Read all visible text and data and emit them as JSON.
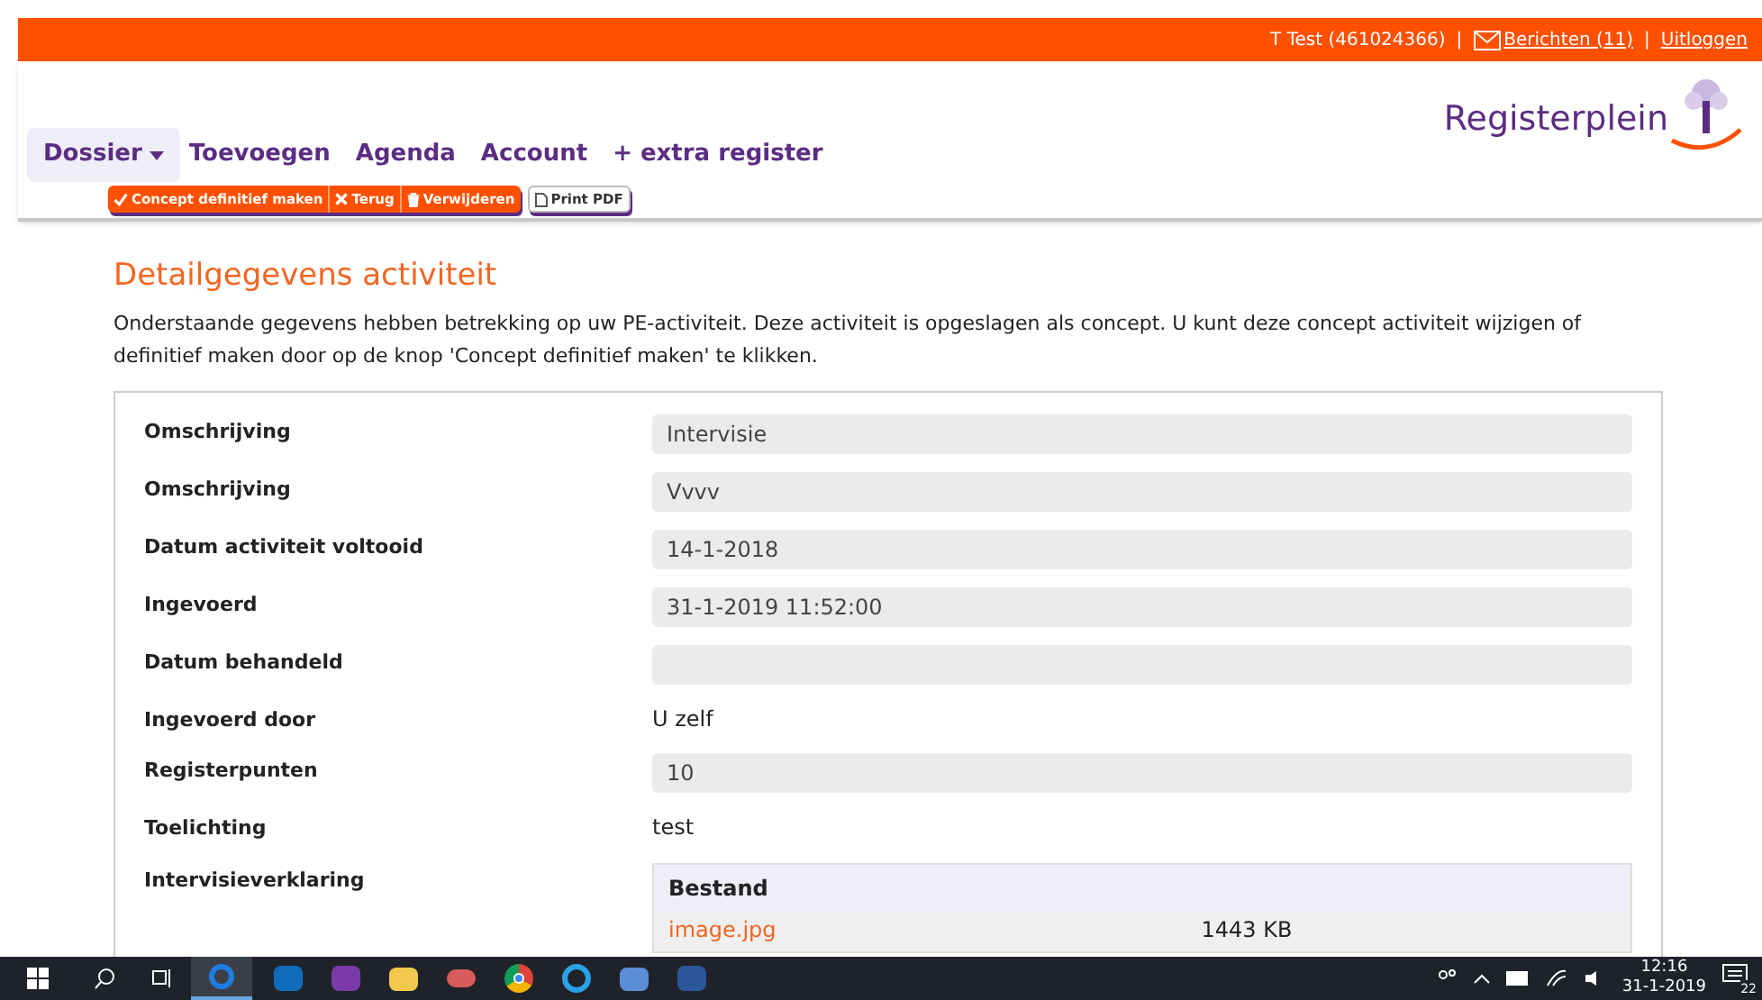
{
  "top_bar": {
    "user": "T Test (461024366)",
    "separator": "|",
    "messages": "Berichten (11)",
    "logout": "Uitloggen"
  },
  "logo": {
    "text": "Registerplein"
  },
  "nav": [
    {
      "label": "Dossier",
      "selected": true,
      "dropdown": true
    },
    {
      "label": "Toevoegen",
      "selected": false,
      "dropdown": false
    },
    {
      "label": "Agenda",
      "selected": false,
      "dropdown": false
    },
    {
      "label": "Account",
      "selected": false,
      "dropdown": false
    },
    {
      "label": "+ extra register",
      "selected": false,
      "dropdown": false
    }
  ],
  "actions": [
    {
      "label": "Concept definitief maken",
      "kind": "check"
    },
    {
      "label": "Terug",
      "kind": "close"
    },
    {
      "label": "Verwijderen",
      "kind": "trash"
    }
  ],
  "print_button": "Print PDF",
  "title": "Detailgegevens activiteit",
  "intro": "Onderstaande gegevens hebben betrekking op uw PE-activiteit. Deze activiteit is opgeslagen als concept. U kunt deze concept activiteit wijzigen of definitief maken door op de knop 'Concept definitief maken' te klikken.",
  "fields": [
    {
      "label": "Omschrijving",
      "kind": "field",
      "value": "Intervisie"
    },
    {
      "label": "Omschrijving",
      "kind": "field",
      "value": "Vvvv"
    },
    {
      "label": "Datum activiteit voltooid",
      "kind": "field",
      "value": "14-1-2018"
    },
    {
      "label": "Ingevoerd",
      "kind": "field",
      "value": "31-1-2019 11:52:00"
    },
    {
      "label": "Datum behandeld",
      "kind": "field"
    },
    {
      "label": "Ingevoerd door",
      "kind": "text",
      "value": "U zelf"
    },
    {
      "label": "Registerpunten",
      "kind": "field",
      "value": "10"
    },
    {
      "label": "Toelichting",
      "kind": "text",
      "value": "test"
    },
    {
      "label": "Intervisieverklaring",
      "kind": "table",
      "header": "Bestand",
      "rows": [
        {
          "file": "image.jpg",
          "size": "1443 KB"
        }
      ]
    }
  ],
  "taskbar": {
    "time": "12:16",
    "date": "31-1-2019",
    "notifications": "22"
  }
}
